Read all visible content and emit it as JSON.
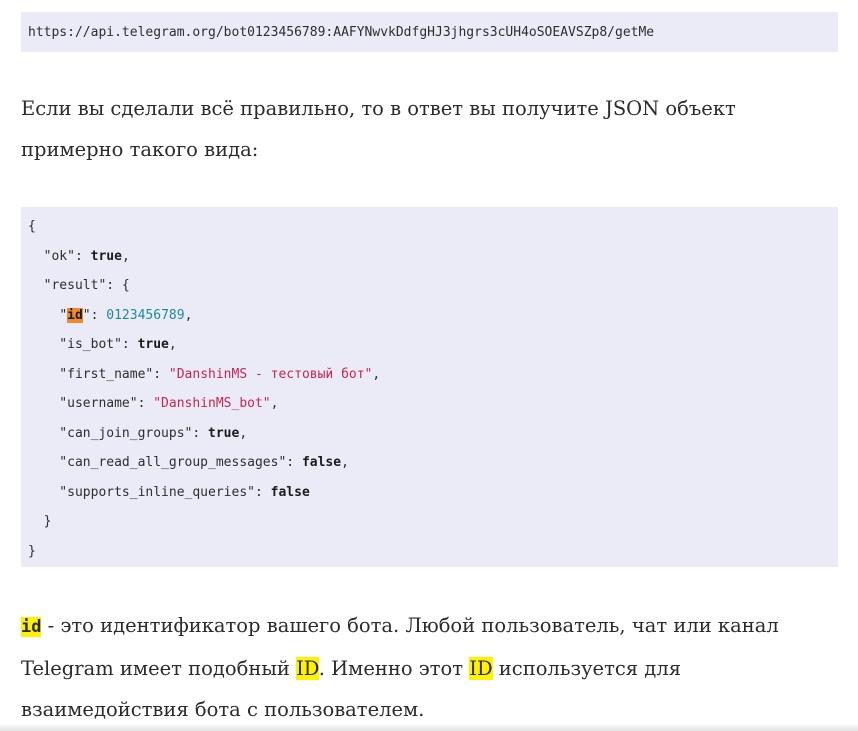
{
  "url_block": {
    "text": "https://api.telegram.org/bot0123456789:AAFYNwvkDdfgHJ3jhgrs3cUH4oSOEAVSZp8/getMe"
  },
  "intro_paragraph": {
    "line1": "Если вы сделали всё правильно, то в ответ вы получите JSON объект",
    "line2": "примерно такого вида:"
  },
  "json_block": {
    "open_brace": "{",
    "ok_indent": "  ",
    "ok_key": "\"ok\"",
    "ok_value": "true",
    "result_line": "  \"result\": {",
    "id_indent": "    ",
    "id_quote_open": "\"",
    "id_key": "id",
    "id_quote_close": "\": ",
    "id_value": "0123456789",
    "is_bot_key": "    \"is_bot\": ",
    "is_bot_value": "true",
    "first_name_key": "    \"first_name\": ",
    "first_name_value": "\"DanshinMS - тестовый бот\"",
    "username_key": "    \"username\": ",
    "username_value": "\"DanshinMS_bot\"",
    "can_join_groups_key": "    \"can_join_groups\": ",
    "can_join_groups_value": "true",
    "can_read_key": "    \"can_read_all_group_messages\": ",
    "can_read_value": "false",
    "supports_inline_key": "    \"supports_inline_queries\": ",
    "supports_inline_value": "false",
    "inner_close": "  }",
    "close_brace": "}"
  },
  "explanation_paragraph": {
    "id_term": "id",
    "part1": " - это идентификатор вашего бота. Любой пользователь, чат или канал",
    "part2": "Telegram имеет подобный ",
    "id_upper_1": "ID",
    "part3": ". Именно этот ",
    "id_upper_2": "ID",
    "part4": " используется для",
    "part5": "взаимедойствия бота с пользователем."
  },
  "colors": {
    "code_background": "#ebebf8",
    "highlight_orange": "#f28a2c",
    "highlight_yellow": "#fff200",
    "number_color": "#1c8a9a",
    "string_color": "#c7254e"
  }
}
